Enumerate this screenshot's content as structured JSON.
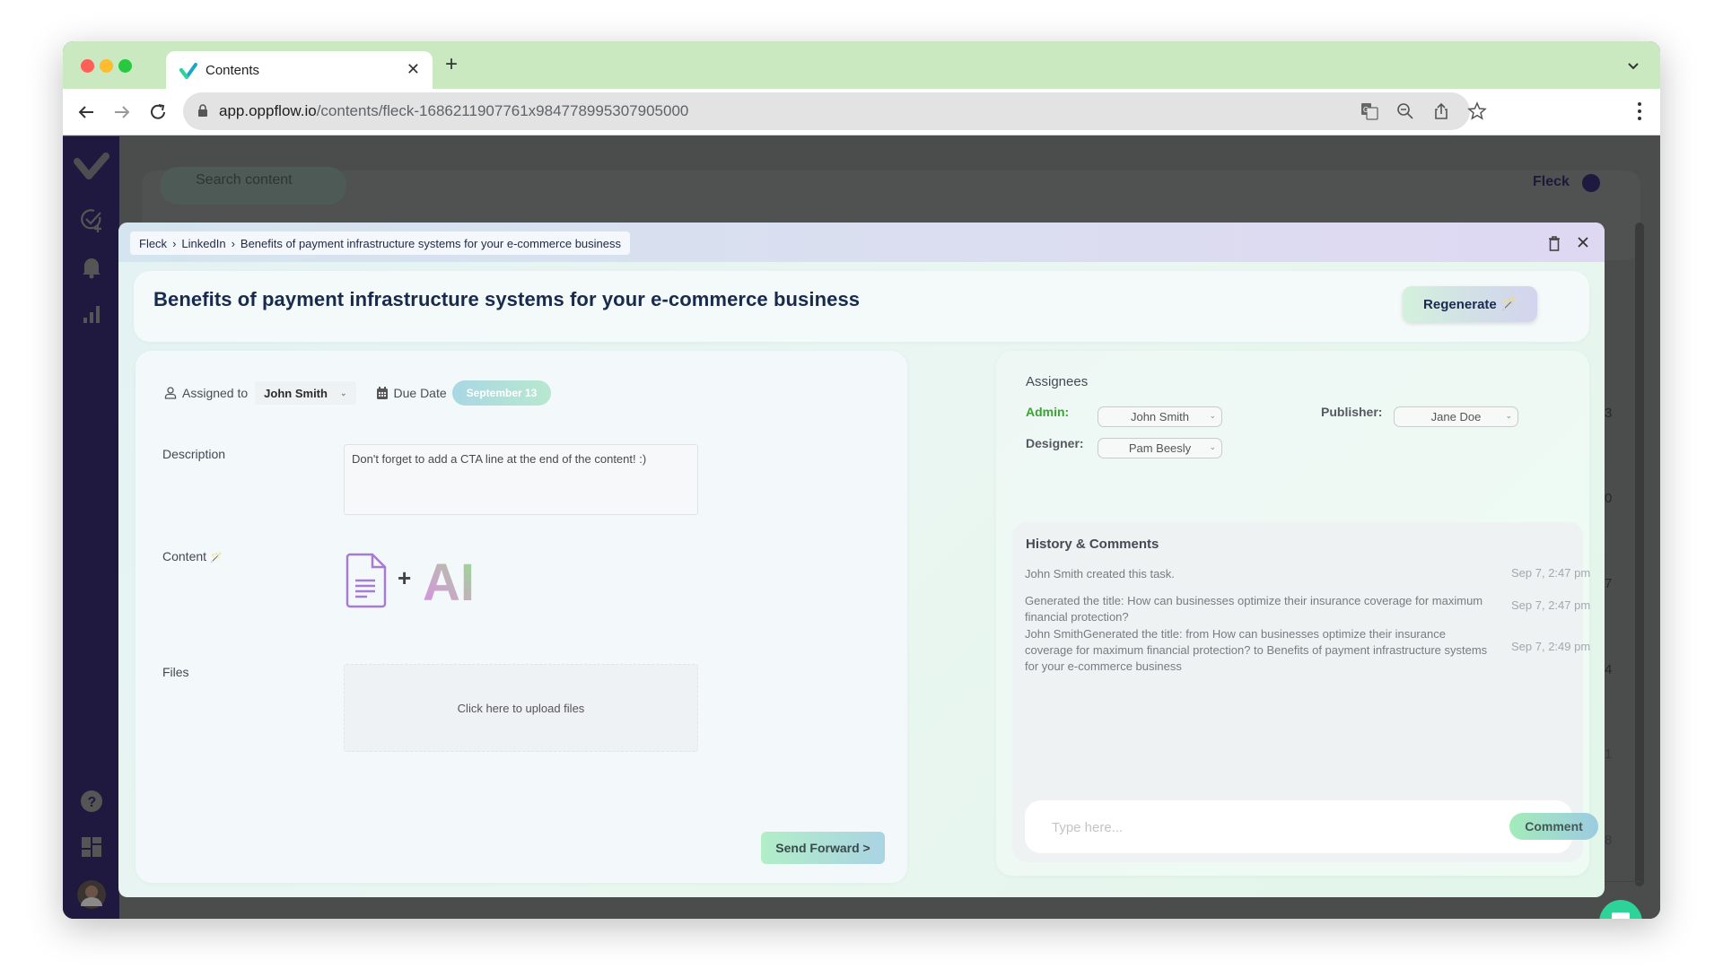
{
  "browser": {
    "tab_title": "Contents",
    "url_host": "app.oppflow.io",
    "url_path": "/contents/fleck-1686211907761x984778995307905000",
    "icons": [
      "translate-icon",
      "zoom-out-icon",
      "share-icon",
      "bookmark-star-icon"
    ]
  },
  "app": {
    "sidebar_icons": [
      "oppflow-logo",
      "add-task-icon",
      "bell-icon",
      "analytics-icon",
      "help-icon",
      "dashboard-icon",
      "user-avatar"
    ],
    "background": {
      "search_placeholder": "Search content",
      "workspace": "Fleck",
      "calendar_digits": [
        "3",
        "0",
        "7",
        "4",
        "1",
        "8"
      ]
    }
  },
  "modal": {
    "breadcrumb": [
      "Fleck",
      "LinkedIn",
      "Benefits of payment infrastructure systems for your e-commerce business"
    ],
    "breadcrumb_sep": "›",
    "title": "Benefits of payment infrastructure systems for your e-commerce business",
    "regenerate_label": "Regenerate",
    "regenerate_icon": "🪄",
    "left": {
      "assigned_to_label": "Assigned to",
      "assignee": "John Smith",
      "due_date_label": "Due Date",
      "due_date": "September 13",
      "description_label": "Description",
      "description": "Don't forget to add a CTA line at the end of the content! :)",
      "content_label": "Content",
      "content_icon": "🪄",
      "content_plus": "+",
      "content_ai": "AI",
      "files_label": "Files",
      "upload_label": "Click here to upload files",
      "send_forward_label": "Send Forward >"
    },
    "right": {
      "assignees_title": "Assignees",
      "roles": [
        {
          "label": "Admin:",
          "value": "John Smith",
          "color": "#3aa531"
        },
        {
          "label": "Publisher:",
          "value": "Jane Doe"
        },
        {
          "label": "Designer:",
          "value": "Pam Beesly"
        }
      ],
      "history_title": "History & Comments",
      "history": [
        {
          "text": "John Smith created this task.",
          "time": "Sep 7, 2:47 pm"
        },
        {
          "text": "Generated the title: How can businesses optimize their insurance coverage for maximum financial protection?",
          "time": "Sep 7, 2:47 pm"
        },
        {
          "text": "John SmithGenerated the title:  from How can businesses optimize their insurance coverage for maximum financial protection? to Benefits of payment infrastructure systems for your e-commerce business",
          "time": "Sep 7, 2:49 pm"
        }
      ],
      "comment_placeholder": "Type here...",
      "comment_label": "Comment"
    }
  },
  "colors": {
    "sidebar": "#1f183f",
    "tabbar": "#cbe9c1",
    "title_text": "#182a4d",
    "chat_fab": "#2ed39a",
    "admin_label": "#3aa531"
  }
}
